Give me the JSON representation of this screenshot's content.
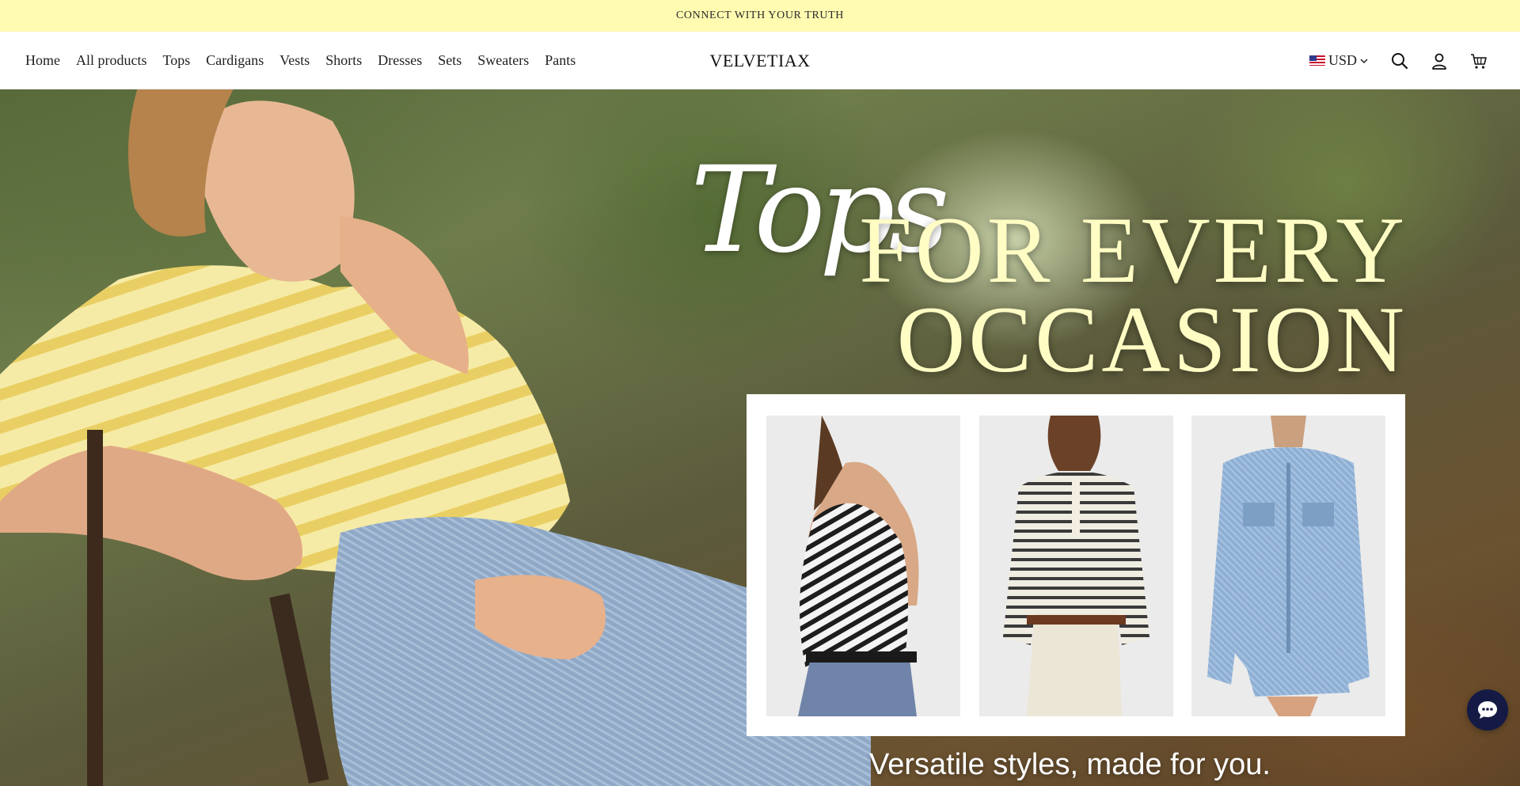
{
  "announcement": {
    "text": "CONNECT WITH YOUR TRUTH"
  },
  "nav": {
    "items": [
      {
        "label": "Home"
      },
      {
        "label": "All products"
      },
      {
        "label": "Tops"
      },
      {
        "label": "Cardigans"
      },
      {
        "label": "Vests"
      },
      {
        "label": "Shorts"
      },
      {
        "label": "Dresses"
      },
      {
        "label": "Sets"
      },
      {
        "label": "Sweaters"
      },
      {
        "label": "Pants"
      }
    ]
  },
  "brand": {
    "logo": "VELVETIAX"
  },
  "header": {
    "currency": "USD",
    "icons": [
      "us-flag-icon",
      "chevron-down-icon",
      "search-icon",
      "account-icon",
      "cart-icon"
    ]
  },
  "hero": {
    "script_word": "Tops",
    "line1": "FOR EVERY",
    "line2": "OCCASION",
    "tagline": "Versatile styles, made for you.",
    "products": [
      {
        "name": "striped-one-shoulder-top"
      },
      {
        "name": "striped-henley-top"
      },
      {
        "name": "denim-shirt-dress"
      }
    ]
  },
  "colors": {
    "announcement_bg": "#fffbb1",
    "headline": "#fffcc4",
    "chat_button": "#141a44"
  },
  "chat": {
    "icon": "chat-bubble-icon"
  }
}
